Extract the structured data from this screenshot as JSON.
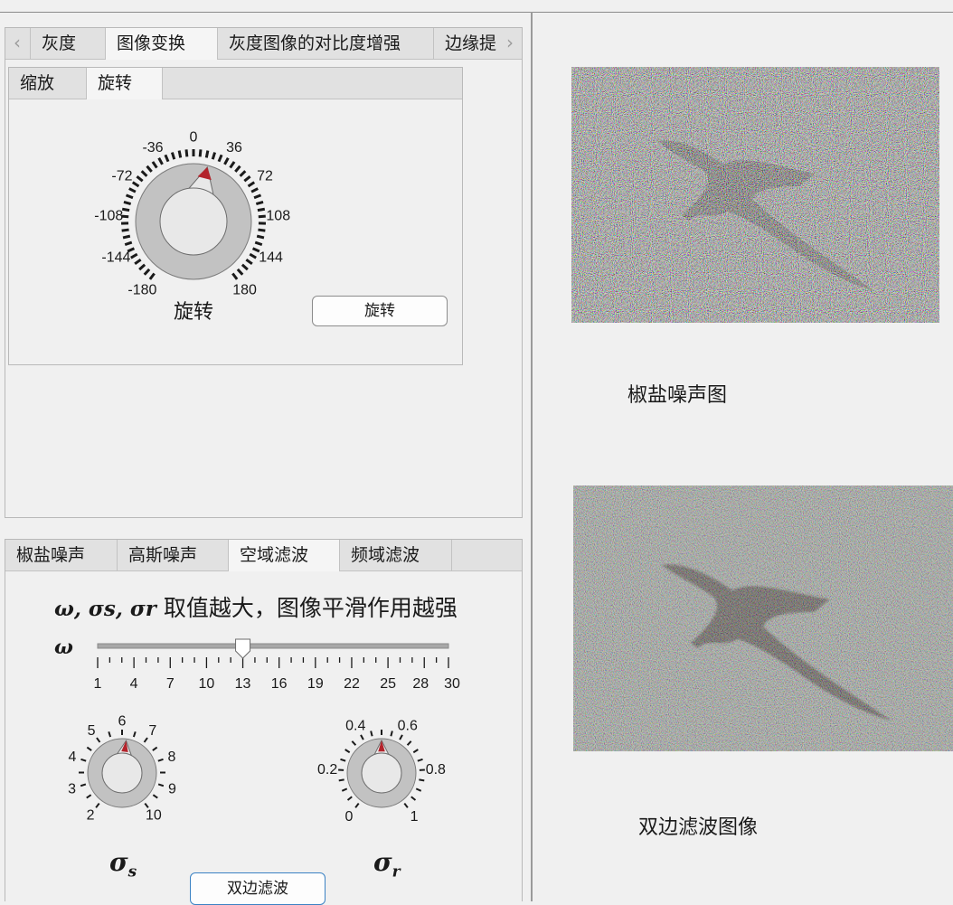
{
  "top_panel": {
    "tabs": [
      "灰度",
      "图像变换",
      "灰度图像的对比度增强",
      "边缘提"
    ],
    "active_tab": "图像变换",
    "inner_tabs": [
      "缩放",
      "旋转"
    ],
    "active_inner_tab": "旋转",
    "rotation_knob": {
      "label": "旋转",
      "tick_labels": [
        "0",
        "36",
        "72",
        "108",
        "144",
        "180",
        "-180",
        "-144",
        "-108",
        "-72",
        "-36"
      ],
      "value": 18
    },
    "rotate_button": "旋转"
  },
  "bottom_panel": {
    "tabs": [
      "椒盐噪声",
      "高斯噪声",
      "空域滤波",
      "频域滤波"
    ],
    "active_tab": "空域滤波",
    "heading_symbols": "ω, σs, σr",
    "heading_text": "取值越大，图像平滑作用越强",
    "omega_slider": {
      "symbol": "ω",
      "tick_labels": [
        "1",
        "4",
        "7",
        "10",
        "13",
        "16",
        "19",
        "22",
        "25",
        "28",
        "30"
      ],
      "value": 13,
      "min": 1,
      "max": 30
    },
    "sigma_s_knob": {
      "symbol": "σ",
      "subscript": "s",
      "tick_labels": [
        "2",
        "3",
        "4",
        "5",
        "6",
        "7",
        "8",
        "9",
        "10"
      ],
      "value": 6.2
    },
    "sigma_r_knob": {
      "symbol": "σ",
      "subscript": "r",
      "tick_labels": [
        "0",
        "0.2",
        "0.4",
        "0.6",
        "0.8",
        "1"
      ],
      "value": 0.5
    },
    "filter_button": "双边滤波"
  },
  "images": {
    "noisy_caption": "椒盐噪声图",
    "filtered_caption": "双边滤波图像"
  }
}
